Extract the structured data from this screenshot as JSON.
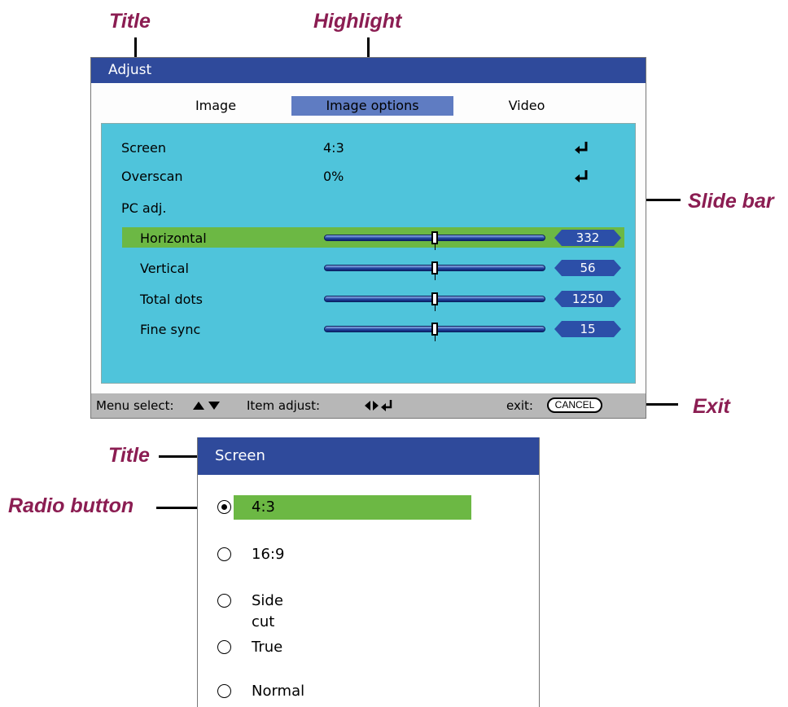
{
  "annotations": {
    "title_top": "Title",
    "highlight": "Highlight",
    "slide_bar": "Slide bar",
    "exit": "Exit",
    "title_bottom": "Title",
    "radio_button": "Radio button"
  },
  "adjust": {
    "title": "Adjust",
    "tabs": [
      {
        "label": "Image",
        "active": false
      },
      {
        "label": "Image options",
        "active": true
      },
      {
        "label": "Video",
        "active": false
      }
    ],
    "rows": [
      {
        "label": "Screen",
        "value": "4:3",
        "icon": "enter-icon"
      },
      {
        "label": "Overscan",
        "value": "0%",
        "icon": "enter-icon"
      },
      {
        "label": "PC adj."
      }
    ],
    "sliders": [
      {
        "label": "Horizontal",
        "value": "332",
        "position": 0.5,
        "selected": true
      },
      {
        "label": "Vertical",
        "value": "56",
        "position": 0.5,
        "selected": false
      },
      {
        "label": "Total dots",
        "value": "1250",
        "position": 0.5,
        "selected": false
      },
      {
        "label": "Fine sync",
        "value": "15",
        "position": 0.5,
        "selected": false
      }
    ],
    "footer": {
      "menu_select": "Menu select:",
      "menu_select_icon": "up-down-arrows-icon",
      "item_adjust": "Item adjust:",
      "item_adjust_icon": "left-right-enter-icon",
      "exit": "exit:",
      "cancel": "CANCEL"
    }
  },
  "screen_menu": {
    "title": "Screen",
    "options": [
      {
        "label": "4:3",
        "selected": true
      },
      {
        "label": "16:9",
        "selected": false
      },
      {
        "label": "Side cut",
        "selected": false
      },
      {
        "label": "True",
        "selected": false
      },
      {
        "label": "Normal",
        "selected": false
      }
    ]
  },
  "colors": {
    "title_bar": "#2f4a9b",
    "tab_highlight": "#5f7cc2",
    "content_bg": "#4fc4db",
    "row_highlight": "#6cb844",
    "footer_bg": "#b7b7b7",
    "callout_text": "#8b1d52"
  }
}
